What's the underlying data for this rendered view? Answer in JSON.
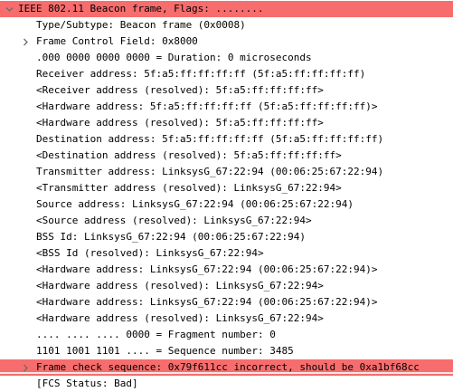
{
  "packet_details": {
    "rows": [
      {
        "text": "IEEE 802.11 Beacon frame, Flags: ........",
        "level": 0,
        "toggle": "expanded",
        "highlight": "error"
      },
      {
        "text": "Type/Subtype: Beacon frame (0x0008)",
        "level": 1,
        "toggle": "none",
        "highlight": "none"
      },
      {
        "text": "Frame Control Field: 0x8000",
        "level": 1,
        "toggle": "collapsed",
        "highlight": "none"
      },
      {
        "text": ".000 0000 0000 0000 = Duration: 0 microseconds",
        "level": 1,
        "toggle": "none",
        "highlight": "none"
      },
      {
        "text": "Receiver address: 5f:a5:ff:ff:ff:ff (5f:a5:ff:ff:ff:ff)",
        "level": 1,
        "toggle": "none",
        "highlight": "none"
      },
      {
        "text": "<Receiver address (resolved): 5f:a5:ff:ff:ff:ff>",
        "level": 1,
        "toggle": "none",
        "highlight": "none"
      },
      {
        "text": "<Hardware address: 5f:a5:ff:ff:ff:ff (5f:a5:ff:ff:ff:ff)>",
        "level": 1,
        "toggle": "none",
        "highlight": "none"
      },
      {
        "text": "<Hardware address (resolved): 5f:a5:ff:ff:ff:ff>",
        "level": 1,
        "toggle": "none",
        "highlight": "none"
      },
      {
        "text": "Destination address: 5f:a5:ff:ff:ff:ff (5f:a5:ff:ff:ff:ff)",
        "level": 1,
        "toggle": "none",
        "highlight": "none"
      },
      {
        "text": "<Destination address (resolved): 5f:a5:ff:ff:ff:ff>",
        "level": 1,
        "toggle": "none",
        "highlight": "none"
      },
      {
        "text": "Transmitter address: LinksysG_67:22:94 (00:06:25:67:22:94)",
        "level": 1,
        "toggle": "none",
        "highlight": "none"
      },
      {
        "text": "<Transmitter address (resolved): LinksysG_67:22:94>",
        "level": 1,
        "toggle": "none",
        "highlight": "none"
      },
      {
        "text": "Source address: LinksysG_67:22:94 (00:06:25:67:22:94)",
        "level": 1,
        "toggle": "none",
        "highlight": "none"
      },
      {
        "text": "<Source address (resolved): LinksysG_67:22:94>",
        "level": 1,
        "toggle": "none",
        "highlight": "none"
      },
      {
        "text": "BSS Id: LinksysG_67:22:94 (00:06:25:67:22:94)",
        "level": 1,
        "toggle": "none",
        "highlight": "none"
      },
      {
        "text": "<BSS Id (resolved): LinksysG_67:22:94>",
        "level": 1,
        "toggle": "none",
        "highlight": "none"
      },
      {
        "text": "<Hardware address: LinksysG_67:22:94 (00:06:25:67:22:94)>",
        "level": 1,
        "toggle": "none",
        "highlight": "none"
      },
      {
        "text": "<Hardware address (resolved): LinksysG_67:22:94>",
        "level": 1,
        "toggle": "none",
        "highlight": "none"
      },
      {
        "text": "<Hardware address: LinksysG_67:22:94 (00:06:25:67:22:94)>",
        "level": 1,
        "toggle": "none",
        "highlight": "none"
      },
      {
        "text": "<Hardware address (resolved): LinksysG_67:22:94>",
        "level": 1,
        "toggle": "none",
        "highlight": "none"
      },
      {
        "text": ".... .... .... 0000 = Fragment number: 0",
        "level": 1,
        "toggle": "none",
        "highlight": "none"
      },
      {
        "text": "1101 1001 1101 .... = Sequence number: 3485",
        "level": 1,
        "toggle": "none",
        "highlight": "none"
      },
      {
        "text": "Frame check sequence: 0x79f611cc incorrect, should be 0xa1bf68cc",
        "level": 1,
        "toggle": "collapsed",
        "highlight": "error"
      },
      {
        "text": "[FCS Status: Bad]",
        "level": 1,
        "toggle": "none",
        "highlight": "none"
      }
    ]
  },
  "colors": {
    "error_highlight": "#f76d6d",
    "text": "#000000",
    "toggle_arrow": "#6b6b6b"
  }
}
